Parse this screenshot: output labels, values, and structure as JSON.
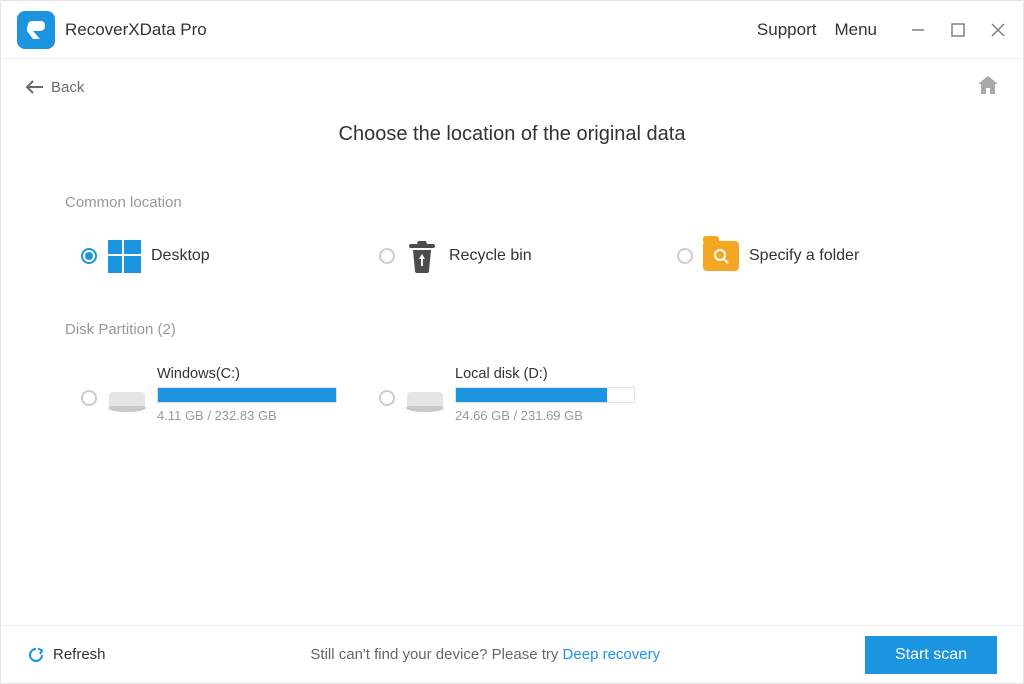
{
  "titlebar": {
    "app_name": "RecoverXData Pro",
    "support_label": "Support",
    "menu_label": "Menu"
  },
  "topbar": {
    "back_label": "Back"
  },
  "main": {
    "title": "Choose the location of the original data",
    "common_label": "Common location",
    "options": {
      "desktop": "Desktop",
      "recycle": "Recycle bin",
      "specify": "Specify a folder"
    },
    "disk_label": "Disk Partition  (2)",
    "partitions": [
      {
        "name": "Windows(C:)",
        "size": "4.11 GB / 232.83 GB",
        "fill_percent": 100
      },
      {
        "name": "Local disk (D:)",
        "size": "24.66 GB / 231.69 GB",
        "fill_percent": 85
      }
    ]
  },
  "bottombar": {
    "refresh_label": "Refresh",
    "hint_text": "Still can't find your device? Please try ",
    "deep_label": "Deep recovery",
    "start_label": "Start scan"
  }
}
